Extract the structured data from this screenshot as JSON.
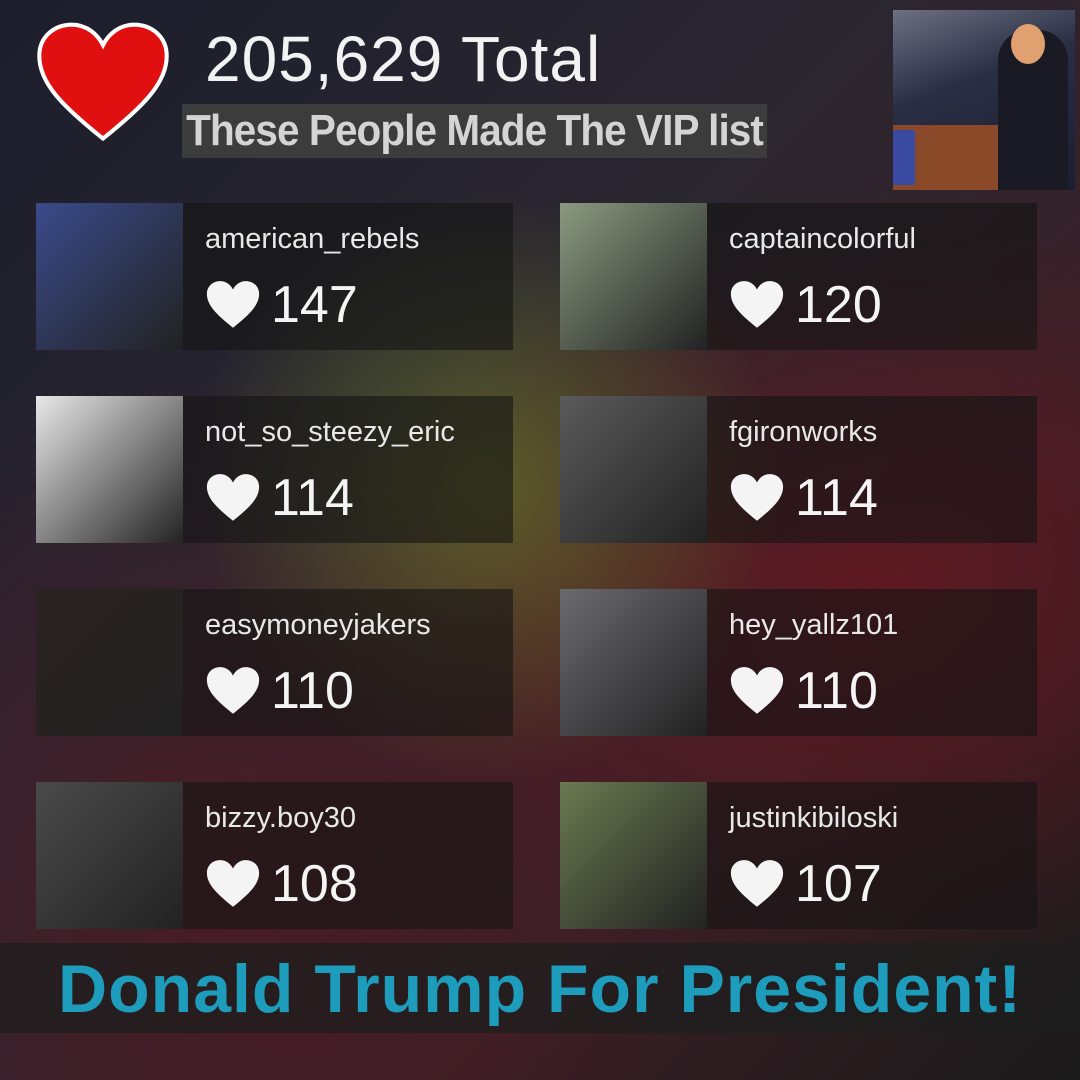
{
  "header": {
    "total": "205,629 Total",
    "subtitle": "These People Made The VIP list"
  },
  "colors": {
    "heart": "#e01010",
    "slogan": "#1e9cbc"
  },
  "users": [
    {
      "name": "american_rebels",
      "likes": "147",
      "avatar": "#3a4a8a"
    },
    {
      "name": "captaincolorful",
      "likes": "120",
      "avatar": "#8a9a80"
    },
    {
      "name": "not_so_steezy_eric",
      "likes": "114",
      "avatar": "#e8e8e8"
    },
    {
      "name": "fgironworks",
      "likes": "114",
      "avatar": "#5a5a5a"
    },
    {
      "name": "easymoneyjakers",
      "likes": "110",
      "avatar": "#2a2220"
    },
    {
      "name": "hey_yallz101",
      "likes": "110",
      "avatar": "#6a6a70"
    },
    {
      "name": "bizzy.boy30",
      "likes": "108",
      "avatar": "#4a4a4a"
    },
    {
      "name": "justinkibiloski",
      "likes": "107",
      "avatar": "#6a7a50"
    }
  ],
  "footer": {
    "slogan": "Donald Trump For President!"
  }
}
